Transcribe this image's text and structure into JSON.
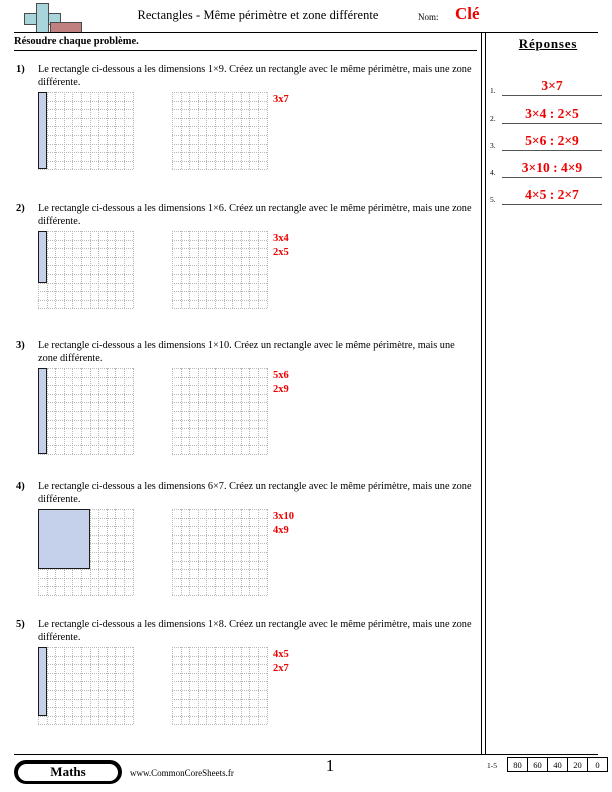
{
  "header": {
    "title": "Rectangles - Même périmètre et zone différente",
    "name_label": "Nom:",
    "name_value": "Clé",
    "logo_icon": "cross-book-logo"
  },
  "directions": "Résoudre chaque problème.",
  "answers_panel": {
    "title": "Réponses",
    "rows": [
      {
        "num": "1.",
        "value": "3×7"
      },
      {
        "num": "2.",
        "value": "3×4 : 2×5"
      },
      {
        "num": "3.",
        "value": "5×6 : 2×9"
      },
      {
        "num": "4.",
        "value": "3×10 : 4×9"
      },
      {
        "num": "5.",
        "value": "4×5 : 2×7"
      }
    ]
  },
  "problems": [
    {
      "num": "1)",
      "text": "Le rectangle ci-dessous a les dimensions 1×9. Créez un rectangle avec le même périmètre, mais une zone différente.",
      "shape_w": 1,
      "shape_h": 9,
      "answers": [
        "3x7"
      ]
    },
    {
      "num": "2)",
      "text": "Le rectangle ci-dessous a les dimensions 1×6. Créez un rectangle avec le même périmètre, mais une zone différente.",
      "shape_w": 1,
      "shape_h": 6,
      "answers": [
        "3x4",
        "2x5"
      ]
    },
    {
      "num": "3)",
      "text": "Le rectangle ci-dessous a les dimensions 1×10. Créez un rectangle avec le même périmètre, mais une zone différente.",
      "shape_w": 1,
      "shape_h": 10,
      "answers": [
        "5x6",
        "2x9"
      ]
    },
    {
      "num": "4)",
      "text": "Le rectangle ci-dessous a les dimensions 6×7. Créez un rectangle avec le même périmètre, mais une zone différente.",
      "shape_w": 6,
      "shape_h": 7,
      "answers": [
        "3x10",
        "4x9"
      ]
    },
    {
      "num": "5)",
      "text": "Le rectangle ci-dessous a les dimensions 1×8. Créez un rectangle avec le même périmètre, mais une zone différente.",
      "shape_w": 1,
      "shape_h": 8,
      "answers": [
        "4x5",
        "2x7"
      ]
    }
  ],
  "footer": {
    "badge": "Maths",
    "url": "www.CommonCoreSheets.fr",
    "page": "1",
    "score_range": "1-5",
    "scores": [
      "80",
      "60",
      "40",
      "20",
      "0"
    ]
  }
}
